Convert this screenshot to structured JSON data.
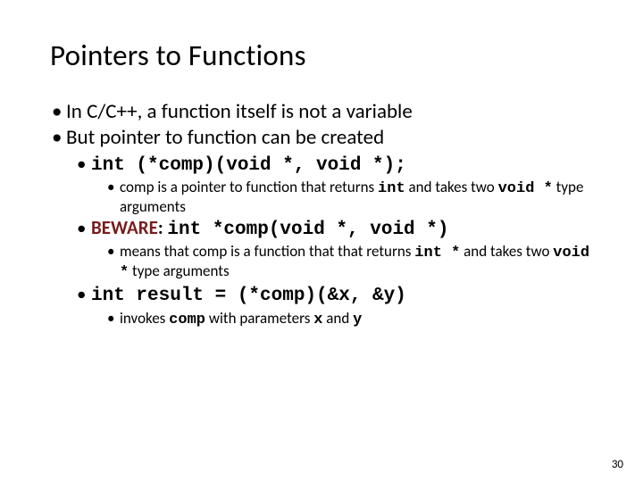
{
  "slide": {
    "title": "Pointers to Functions",
    "pageNumber": "30",
    "bullets": {
      "b1": "In C/C++, a function itself is not a variable",
      "b2": "But pointer to function can be created",
      "code1": "int (*comp)(void *, void *);",
      "expl1_a": "comp is a pointer to function that returns ",
      "expl1_b": "int",
      "expl1_c": " and takes two ",
      "expl1_d": "void *",
      "expl1_e": " type arguments",
      "beware": "BEWARE",
      "beware_sep": ": ",
      "code2": "int *comp(void *, void *)",
      "expl2_a": "means that comp is a function that that returns ",
      "expl2_b": "int *",
      "expl2_c": " and takes two ",
      "expl2_d": "void *",
      "expl2_e": " type arguments",
      "code3": "int result = (*comp)(&x, &y)",
      "expl3_a": "invokes ",
      "expl3_b": "comp",
      "expl3_c": " with parameters ",
      "expl3_d": "x",
      "expl3_e": " and ",
      "expl3_f": "y"
    }
  }
}
